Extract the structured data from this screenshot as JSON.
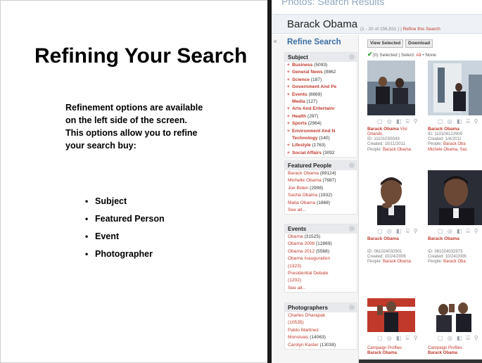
{
  "slide": {
    "title": "Refining Your Search",
    "description": "Refinement options are available on the left side of the screen.  This options allow you to refine your search buy:",
    "bullets": [
      "Subject",
      "Featured Person",
      "Event",
      "Photographer"
    ]
  },
  "screenshot": {
    "page_heading": "Photos: Search Results",
    "query": "Barack Obama",
    "result_meta": "(1 - 20 of 156,831 )",
    "refine_link": "Refine this Search",
    "refine_panel_title": "Refine Search",
    "view_selected_button": "View Selected",
    "download_button": "Download",
    "selected_count": "(0) Selected",
    "select_label": "Select:",
    "select_all": "All",
    "select_none": "None",
    "subject_box": {
      "title": "Subject",
      "items": [
        {
          "label": "Business",
          "count": "(5093)"
        },
        {
          "label": "General News",
          "count": "(9862"
        },
        {
          "label": "Science",
          "count": "(187)"
        },
        {
          "label": "Government And Pe",
          "count": ""
        },
        {
          "label": "Events",
          "count": "(8869)"
        },
        {
          "label": "Media",
          "count": "(127)"
        },
        {
          "label": "Arts And Entertainr",
          "count": ""
        },
        {
          "label": "Health",
          "count": "(297)"
        },
        {
          "label": "Sports",
          "count": "(2964)"
        },
        {
          "label": "Environment And N",
          "count": ""
        },
        {
          "label": "Technology",
          "count": "(140)"
        },
        {
          "label": "Lifestyle",
          "count": "(1763)"
        },
        {
          "label": "Social Affairs",
          "count": "(3092"
        }
      ]
    },
    "featured_box": {
      "title": "Featured People",
      "items": [
        {
          "label": "Barack Obama",
          "count": "(89124)"
        },
        {
          "label": "Michelle Obama",
          "count": "(7687)"
        },
        {
          "label": "Joe Biden",
          "count": "(2998)"
        },
        {
          "label": "Sasha Obama",
          "count": "(1932)"
        },
        {
          "label": "Malia Obama",
          "count": "(1868)"
        },
        {
          "label": "See all...",
          "count": ""
        }
      ]
    },
    "events_box": {
      "title": "Events",
      "items": [
        {
          "label": "Obama",
          "count": "(31525)"
        },
        {
          "label": "Obama 2008",
          "count": "(12869)"
        },
        {
          "label": "Obama 2012",
          "count": "(5568)"
        },
        {
          "label": "Obama Inauguration",
          "count": ""
        },
        {
          "label": "(1323)",
          "count": ""
        },
        {
          "label": "Presidential Debate",
          "count": ""
        },
        {
          "label": "(1202)",
          "count": ""
        },
        {
          "label": "See all...",
          "count": ""
        }
      ]
    },
    "photographers_box": {
      "title": "Photographers",
      "items": [
        {
          "label": "Charles Dharapak",
          "count": ""
        },
        {
          "label": "(10535)",
          "count": ""
        },
        {
          "label": "Pablo Martinez",
          "count": ""
        },
        {
          "label": "Monsivais",
          "count": "(14063)"
        },
        {
          "label": "Carolyn Kaster",
          "count": "(13038)"
        }
      ]
    },
    "results": [
      {
        "title": "Barack Obama",
        "title_suffix": "Visi",
        "lines": [
          "Orlando",
          "ID: 1110103S043",
          "Created: 10/11/2011"
        ],
        "people_label": "People:",
        "people": "Barack Obama"
      },
      {
        "title": "Barack Obama",
        "title_suffix": "",
        "lines": [
          "ID: 110104122909",
          "Created: 1/4/2011"
        ],
        "people_label": "People:",
        "people": "Barack Oba",
        "people2": "Michele Obama, Sas"
      },
      {
        "title": "Barack Obama",
        "title_suffix": "",
        "lines": [
          "ID: 061024032901",
          "Created: 10/24/2006"
        ],
        "people_label": "People:",
        "people": "Barack Obama"
      },
      {
        "title": "Barack Obama",
        "title_suffix": "",
        "lines": [
          "ID: 061024032973",
          "Created: 10/24/2006"
        ],
        "people_label": "People:",
        "people": "Barack Oba"
      },
      {
        "title": "Campaign Profiles",
        "title2": "Barack Obama"
      },
      {
        "title": "Campaign Profiles",
        "title2": "Barack Obama"
      }
    ],
    "action_icons": "▢ ◎ ◧ ⌸ ⚲"
  },
  "colors": {
    "link": "#c0392b",
    "accent": "#3b6fa3",
    "check": "#2e9e3a"
  }
}
